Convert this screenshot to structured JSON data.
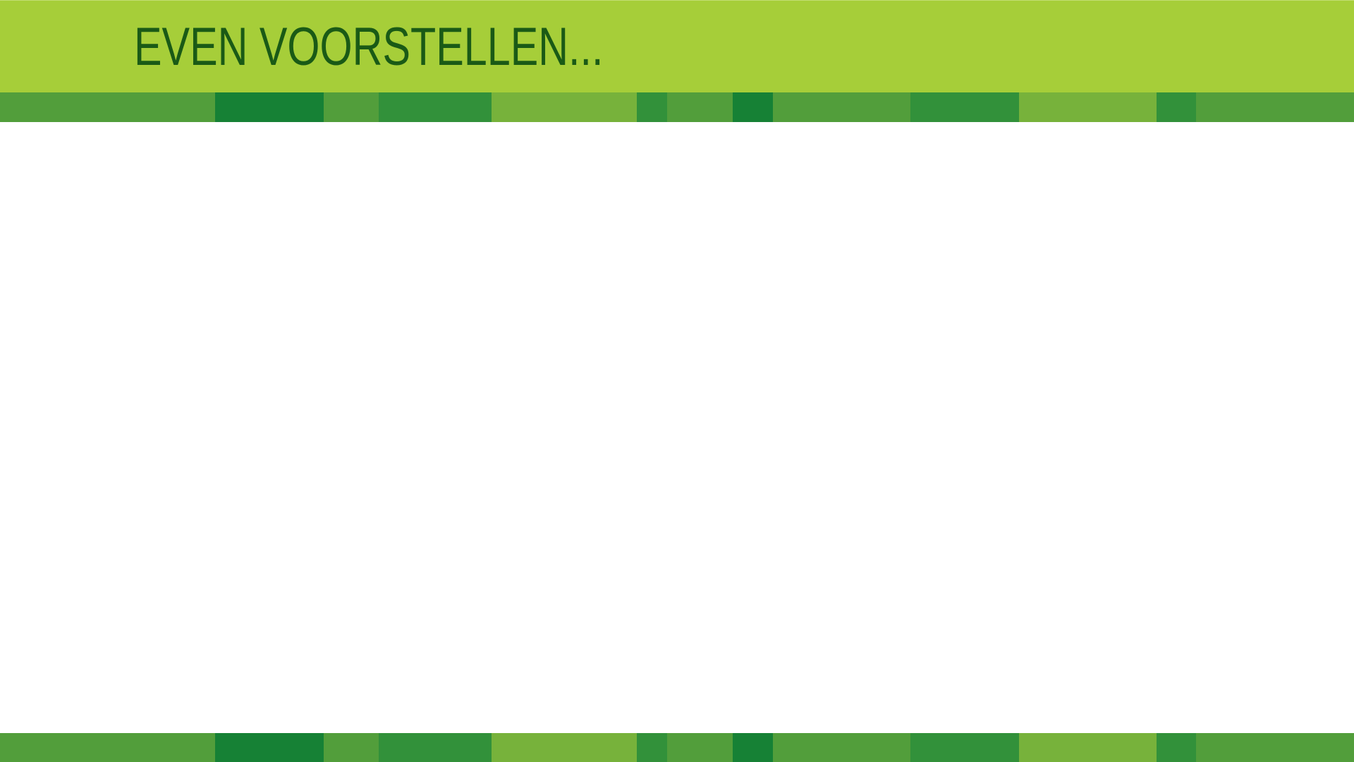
{
  "slide": {
    "title": "EVEN VOORSTELLEN..."
  },
  "colors": {
    "header_background": "#a6ce39",
    "title_text": "#1a5a16",
    "stripe_palette": [
      "#529e3b",
      "#168135",
      "#32913a",
      "#77b23b"
    ]
  }
}
